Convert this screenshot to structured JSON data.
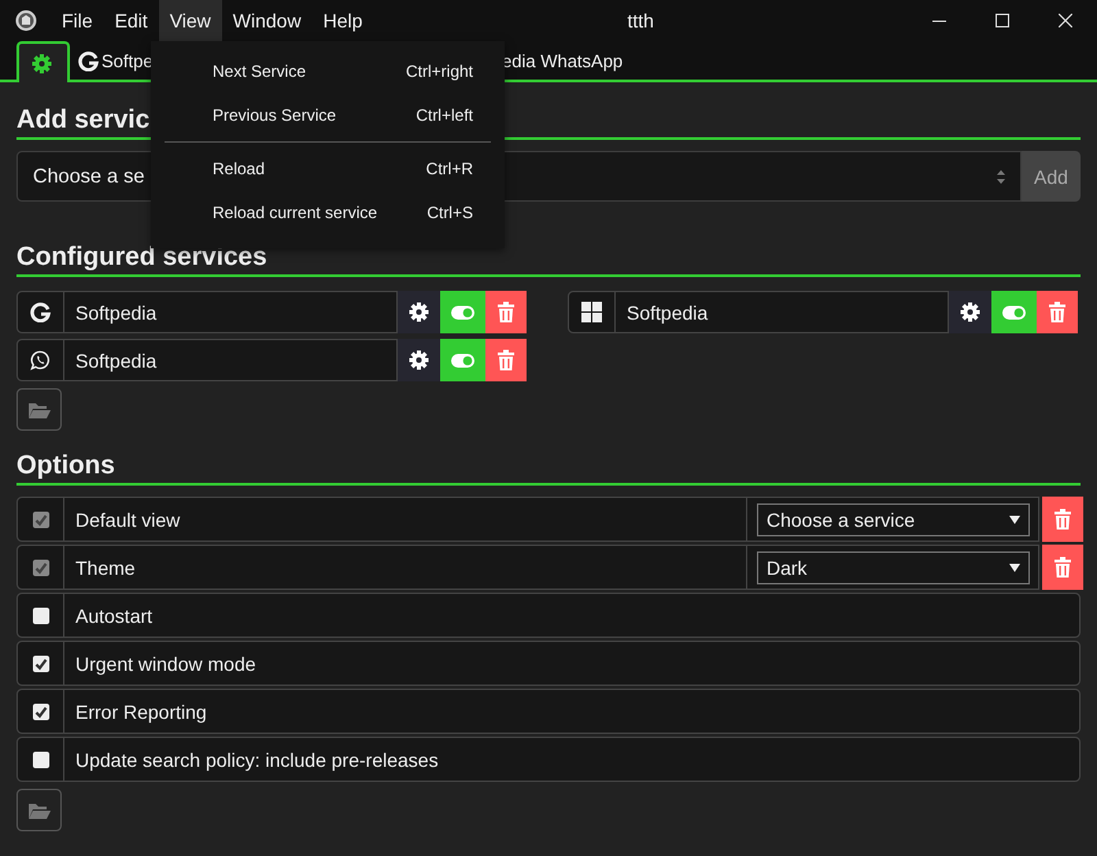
{
  "window": {
    "title": "ttth"
  },
  "menu_bar": [
    {
      "label": "File",
      "selected": false
    },
    {
      "label": "Edit",
      "selected": false
    },
    {
      "label": "View",
      "selected": true
    },
    {
      "label": "Window",
      "selected": false
    },
    {
      "label": "Help",
      "selected": false
    }
  ],
  "open_menu": {
    "items": [
      {
        "kind": "item",
        "label": "Next Service",
        "shortcut": "Ctrl+right"
      },
      {
        "kind": "item",
        "label": "Previous Service",
        "shortcut": "Ctrl+left"
      },
      {
        "kind": "separator"
      },
      {
        "kind": "item",
        "label": "Reload",
        "shortcut": "Ctrl+R"
      },
      {
        "kind": "item",
        "label": "Reload current service",
        "shortcut": "Ctrl+S"
      }
    ]
  },
  "tabs": [
    {
      "kind": "settings",
      "selected": true
    },
    {
      "kind": "google",
      "label": "Softpe",
      "selected": false
    },
    {
      "kind": "plain",
      "label": "edia WhatsApp",
      "selected": false
    }
  ],
  "add_service": {
    "heading": "Add servic",
    "select_value": "Choose a se",
    "button": "Add"
  },
  "configured_services": {
    "heading": "Configured services",
    "services": [
      {
        "kind": "google",
        "name": "Softpedia",
        "enabled": true
      },
      {
        "kind": "windows",
        "name": "Softpedia",
        "enabled": true
      },
      {
        "kind": "whatsapp",
        "name": "Softpedia",
        "enabled": true
      }
    ]
  },
  "options": {
    "heading": "Options",
    "items": [
      {
        "kind": "select",
        "label": "Default view",
        "checked": true,
        "disabled": true,
        "value": "Choose a service"
      },
      {
        "kind": "select",
        "label": "Theme",
        "checked": true,
        "disabled": true,
        "value": "Dark"
      },
      {
        "kind": "checkbox",
        "label": "Autostart",
        "checked": false,
        "disabled": false
      },
      {
        "kind": "checkbox",
        "label": "Urgent window mode",
        "checked": true,
        "disabled": false
      },
      {
        "kind": "checkbox",
        "label": "Error Reporting",
        "checked": true,
        "disabled": false
      },
      {
        "kind": "checkbox",
        "label": "Update search policy: include pre-releases",
        "checked": false,
        "disabled": false
      }
    ]
  }
}
